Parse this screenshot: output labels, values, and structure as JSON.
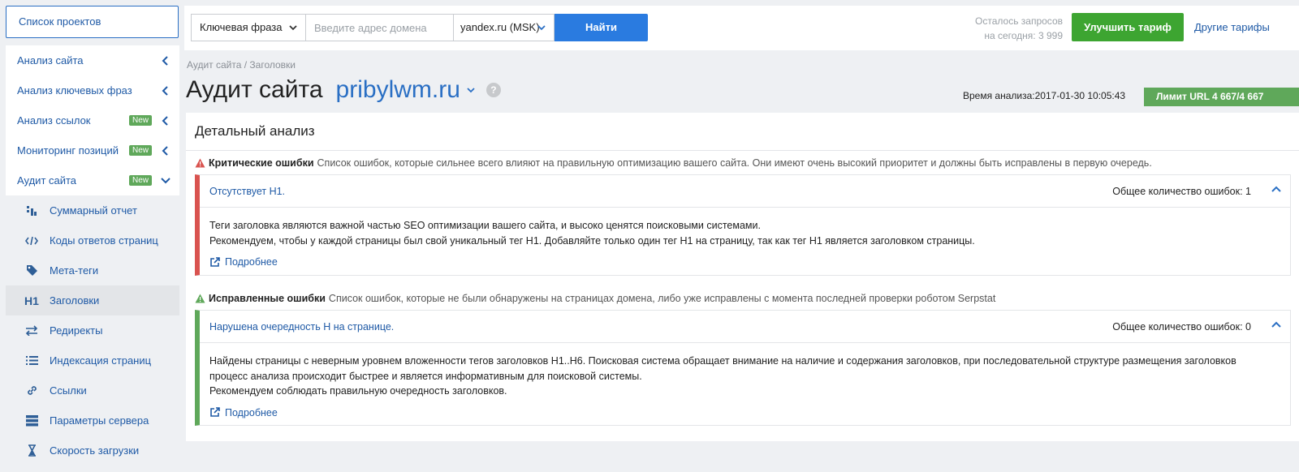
{
  "sidebar": {
    "projects_button": "Список проектов",
    "items": [
      {
        "label": "Анализ сайта",
        "badge": ""
      },
      {
        "label": "Анализ ключевых фраз",
        "badge": ""
      },
      {
        "label": "Анализ ссылок",
        "badge": "New"
      },
      {
        "label": "Мониторинг позиций",
        "badge": "New"
      },
      {
        "label": "Аудит сайта",
        "badge": "New"
      }
    ],
    "subitems": [
      {
        "label": "Суммарный отчет",
        "icon": "chart-icon"
      },
      {
        "label": "Коды ответов страниц",
        "icon": "code-icon"
      },
      {
        "label": "Мета-теги",
        "icon": "tag-icon"
      },
      {
        "label": "Заголовки",
        "icon": "h1-icon",
        "icon_text": "H1",
        "active": true
      },
      {
        "label": "Редиректы",
        "icon": "redirect-arrows-icon"
      },
      {
        "label": "Индексация страниц",
        "icon": "list-icon"
      },
      {
        "label": "Ссылки",
        "icon": "link-icon"
      },
      {
        "label": "Параметры сервера",
        "icon": "server-icon"
      },
      {
        "label": "Скорость загрузки",
        "icon": "hourglass-icon"
      }
    ]
  },
  "topbar": {
    "search_type": "Ключевая фраза",
    "domain_placeholder": "Введите адрес домена",
    "region": "yandex.ru (MSK)",
    "search_button": "Найти",
    "quota_line1": "Осталось запросов",
    "quota_line2": "на сегодня: 3 999",
    "upgrade_button": "Улучшить тариф",
    "other_plans": "Другие тарифы"
  },
  "header": {
    "breadcrumb": "Аудит сайта / Заголовки",
    "title": "Аудит сайта",
    "domain": "pribylwm.ru",
    "help": "?",
    "analysis_time": "Время анализа:2017-01-30 10:05:43",
    "limit": "Лимит URL 4 667/4 667"
  },
  "panel": {
    "title": "Детальный анализ",
    "critical": {
      "heading": "Критические ошибки",
      "description": "Список ошибок, которые сильнее всего влияют на правильную оптимизацию вашего сайта. Они имеют очень высокий приоритет и должны быть исправлены в первую очередь.",
      "card_title": "Отсутствует H1.",
      "count": "Общее количество ошибок: 1",
      "body_line1": "Теги заголовка являются важной частью SEO оптимизации вашего сайта, и высоко ценятся поисковыми системами.",
      "body_line2": "Рекомендуем, чтобы у каждой страницы был свой уникальный тег H1. Добавляйте только один тег H1 на страницу, так как тег H1 является заголовком страницы.",
      "more": "Подробнее"
    },
    "fixed": {
      "heading": "Исправленные ошибки",
      "description": "Список ошибок, которые не были обнаружены на страницах домена, либо уже исправлены с момента последней проверки роботом Serpstat",
      "card_title": "Нарушена очередность H на странице.",
      "count": "Общее количество ошибок: 0",
      "body_line1": "Найдены страницы с неверным уровнем вложенности тегов заголовков H1..H6. Поисковая система обращает внимание на наличие и содержания заголовков, при последовательной структуре размещения заголовков",
      "body_line2": "процесс анализа происходит быстрее и является информативным для поисковой системы.",
      "body_line3": "Рекомендуем соблюдать правильную очередность заголовков.",
      "more": "Подробнее"
    }
  },
  "colors": {
    "accent": "#2a7be0",
    "link": "#1f5aa6",
    "success": "#3da531",
    "danger": "#d9534f"
  }
}
